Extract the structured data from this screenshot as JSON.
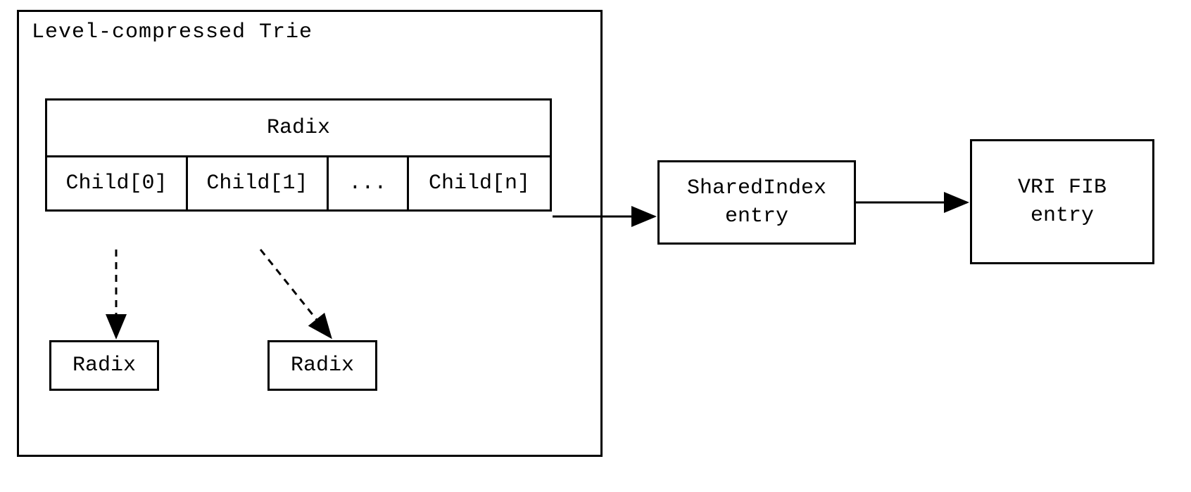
{
  "trie": {
    "title": "Level-compressed Trie",
    "radix_header": "Radix",
    "children": {
      "c0": "Child[0]",
      "c1": "Child[1]",
      "dots": "...",
      "cn": "Child[n]"
    },
    "sub_radix_a": "Radix",
    "sub_radix_b": "Radix"
  },
  "sharedindex": {
    "line1": "SharedIndex",
    "line2": "entry"
  },
  "vri": {
    "line1": "VRI FIB",
    "line2": "entry"
  }
}
